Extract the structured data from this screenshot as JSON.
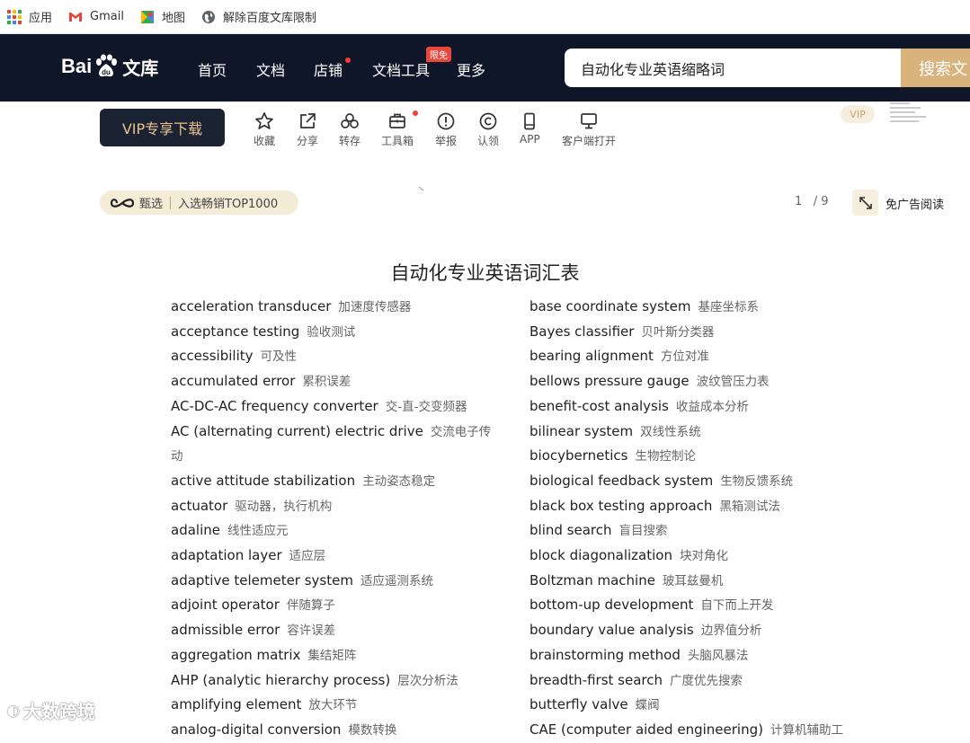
{
  "bookmarks": [
    {
      "label": "应用",
      "icon": "apps-grid-icon"
    },
    {
      "label": "Gmail",
      "icon": "gmail-icon"
    },
    {
      "label": "地图",
      "icon": "maps-icon"
    },
    {
      "label": "解除百度文库限制",
      "icon": "globe-icon"
    }
  ],
  "header": {
    "logo_text_bai": "Bai",
    "logo_text_du": "du",
    "logo_text_wk": "文库",
    "nav": [
      {
        "label": "首页"
      },
      {
        "label": "文档"
      },
      {
        "label": "店铺"
      },
      {
        "label": "文档工具"
      },
      {
        "label": "更多"
      }
    ],
    "limited_badge": "限免",
    "search_value": "自动化专业英语缩略词",
    "search_button": "搜索文"
  },
  "toolbar": {
    "vip_download": "VIP专享下载",
    "tools": [
      {
        "label": "收藏",
        "icon": "star-icon"
      },
      {
        "label": "分享",
        "icon": "share-icon"
      },
      {
        "label": "转存",
        "icon": "save-cloud-icon"
      },
      {
        "label": "工具箱",
        "icon": "toolbox-icon"
      },
      {
        "label": "举报",
        "icon": "report-icon"
      },
      {
        "label": "认领",
        "icon": "copyright-icon"
      },
      {
        "label": "APP",
        "icon": "phone-icon"
      },
      {
        "label": "客户端打开",
        "icon": "monitor-icon"
      }
    ],
    "vip_mini": "VIP"
  },
  "meta": {
    "select_label": "甄选",
    "select_rank": "入选畅销TOP1000",
    "page_current": "1",
    "page_total": "/ 9",
    "no_ad": "免广告阅读"
  },
  "document": {
    "title": "自动化专业英语词汇表",
    "left": [
      {
        "en": "acceleration transducer",
        "zh": "加速度传感器"
      },
      {
        "en": "acceptance testing",
        "zh": "验收测试"
      },
      {
        "en": "accessibility",
        "zh": "可及性"
      },
      {
        "en": "accumulated error",
        "zh": "累积误差"
      },
      {
        "en": "AC-DC-AC frequency converter",
        "zh": "交-直-交变频器"
      },
      {
        "en": "AC (alternating current) electric drive",
        "zh": "交流电子传"
      },
      {
        "en": "",
        "zh": "动"
      },
      {
        "en": "active attitude stabilization",
        "zh": "主动姿态稳定"
      },
      {
        "en": "actuator",
        "zh": "驱动器，执行机构"
      },
      {
        "en": "adaline",
        "zh": "线性适应元"
      },
      {
        "en": "adaptation layer",
        "zh": "适应层"
      },
      {
        "en": "adaptive telemeter system",
        "zh": "适应遥测系统"
      },
      {
        "en": "adjoint operator",
        "zh": "伴随算子"
      },
      {
        "en": "admissible error",
        "zh": "容许误差"
      },
      {
        "en": "aggregation matrix",
        "zh": "集结矩阵"
      },
      {
        "en": "AHP (analytic hierarchy process)",
        "zh": "层次分析法"
      },
      {
        "en": "amplifying element",
        "zh": "放大环节"
      },
      {
        "en": "analog-digital conversion",
        "zh": "模数转换"
      }
    ],
    "right": [
      {
        "en": "base coordinate system",
        "zh": "基座坐标系"
      },
      {
        "en": "Bayes classifier",
        "zh": "贝叶斯分类器"
      },
      {
        "en": "bearing alignment",
        "zh": "方位对准"
      },
      {
        "en": "bellows pressure gauge",
        "zh": "波纹管压力表"
      },
      {
        "en": "benefit-cost analysis",
        "zh": "收益成本分析"
      },
      {
        "en": "bilinear system",
        "zh": "双线性系统"
      },
      {
        "en": "biocybernetics",
        "zh": "生物控制论"
      },
      {
        "en": "biological feedback system",
        "zh": "生物反馈系统"
      },
      {
        "en": "black box testing approach",
        "zh": "黑箱测试法"
      },
      {
        "en": "blind search",
        "zh": "盲目搜索"
      },
      {
        "en": "block diagonalization",
        "zh": "块对角化"
      },
      {
        "en": "Boltzman machine",
        "zh": "玻耳兹曼机"
      },
      {
        "en": "bottom-up development",
        "zh": "自下而上开发"
      },
      {
        "en": "boundary value analysis",
        "zh": "边界值分析"
      },
      {
        "en": "brainstorming method",
        "zh": "头脑风暴法"
      },
      {
        "en": "breadth-first search",
        "zh": "广度优先搜索"
      },
      {
        "en": "butterfly valve",
        "zh": "蝶阀"
      },
      {
        "en": "CAE (computer aided engineering)",
        "zh": "计算机辅助工"
      }
    ]
  },
  "watermark": "大数跨境",
  "colors": {
    "nav_bg": "#0f1628",
    "gold": "#d9b37c",
    "pill_bg": "#f5ecd7"
  }
}
